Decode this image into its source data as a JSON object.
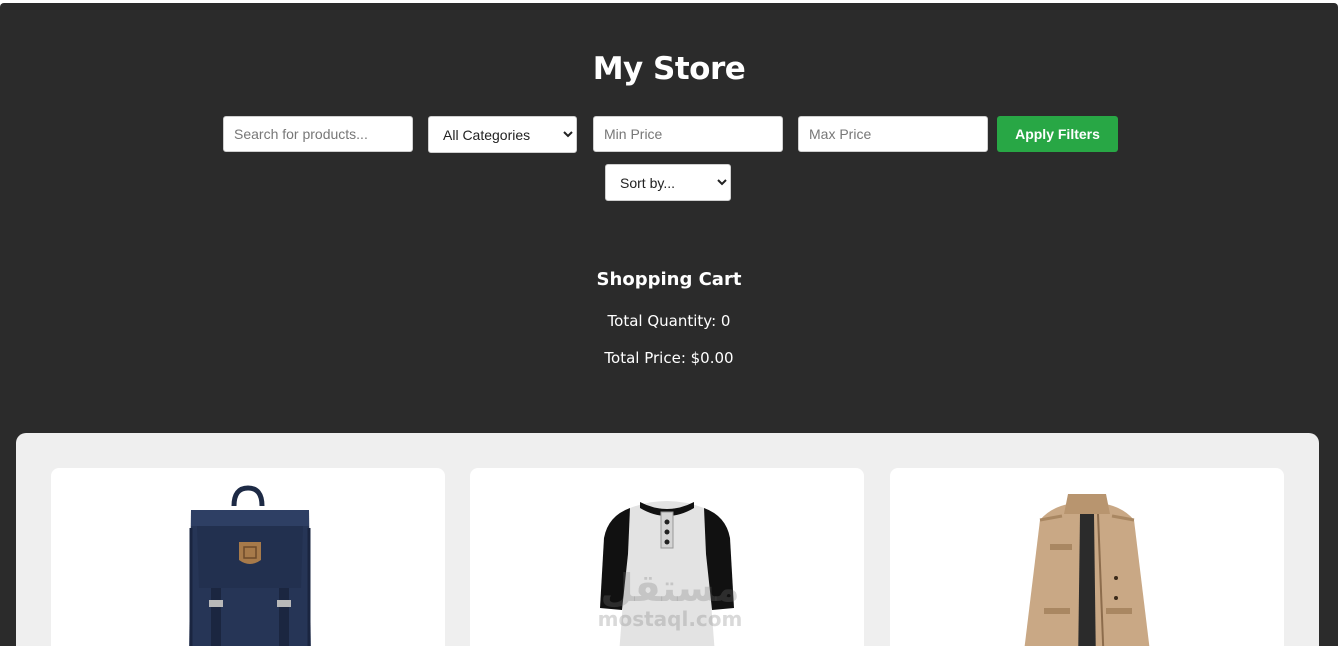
{
  "store": {
    "title": "My Store"
  },
  "filters": {
    "search_placeholder": "Search for products...",
    "category_selected": "All Categories",
    "min_price_placeholder": "Min Price",
    "max_price_placeholder": "Max Price",
    "apply_label": "Apply Filters",
    "sort_selected": "Sort by..."
  },
  "cart": {
    "title": "Shopping Cart",
    "total_quantity": "Total Quantity: 0",
    "total_price": "Total Price: $0.00"
  },
  "products": [
    {
      "image": "navy-backpack-image"
    },
    {
      "image": "raglan-henley-shirt-image"
    },
    {
      "image": "khaki-jacket-image"
    }
  ],
  "watermark": {
    "logo": "مستقل",
    "site": "mostaql.com"
  },
  "colors": {
    "background": "#2b2b2b",
    "apply_button": "#28a745",
    "product_area": "#efefef",
    "card": "#ffffff"
  }
}
